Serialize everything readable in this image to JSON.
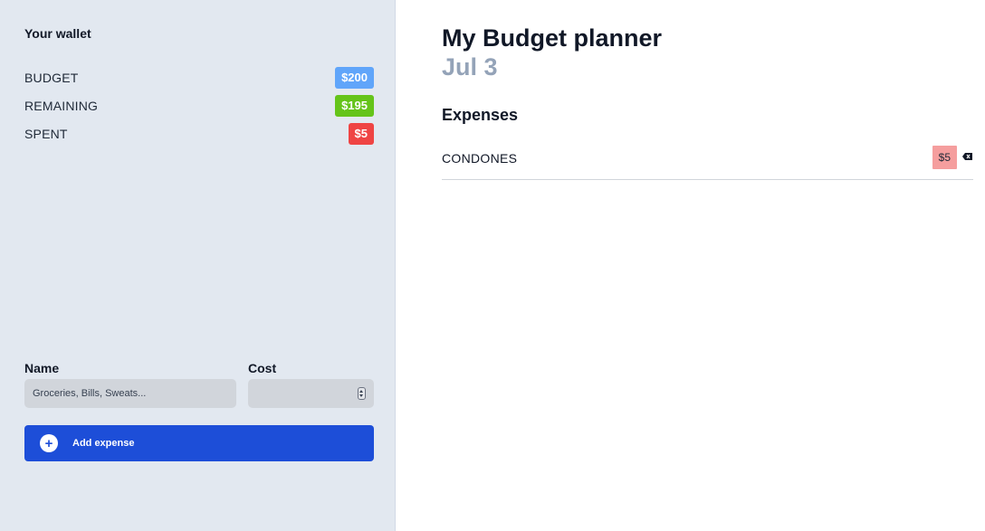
{
  "sidebar": {
    "wallet_title": "Your wallet",
    "stats": [
      {
        "label": "BUDGET",
        "value": "$200",
        "color": "#60a5fa"
      },
      {
        "label": "REMAINING",
        "value": "$195",
        "color": "#65c41a"
      },
      {
        "label": "SPENT",
        "value": "$5",
        "color": "#ef4444"
      }
    ],
    "form": {
      "name_label": "Name",
      "name_placeholder": "Groceries, Bills, Sweats...",
      "name_value": "",
      "cost_label": "Cost",
      "cost_value": "",
      "add_button_label": "Add expense",
      "add_button_icon": "plus-circle-icon",
      "button_color": "#1d4ed8"
    }
  },
  "main": {
    "title": "My Budget planner",
    "date": "Jul 3",
    "expenses_title": "Expenses",
    "expenses": [
      {
        "name": "CONDONES",
        "cost": "$5",
        "delete_icon": "backspace-icon"
      }
    ]
  }
}
